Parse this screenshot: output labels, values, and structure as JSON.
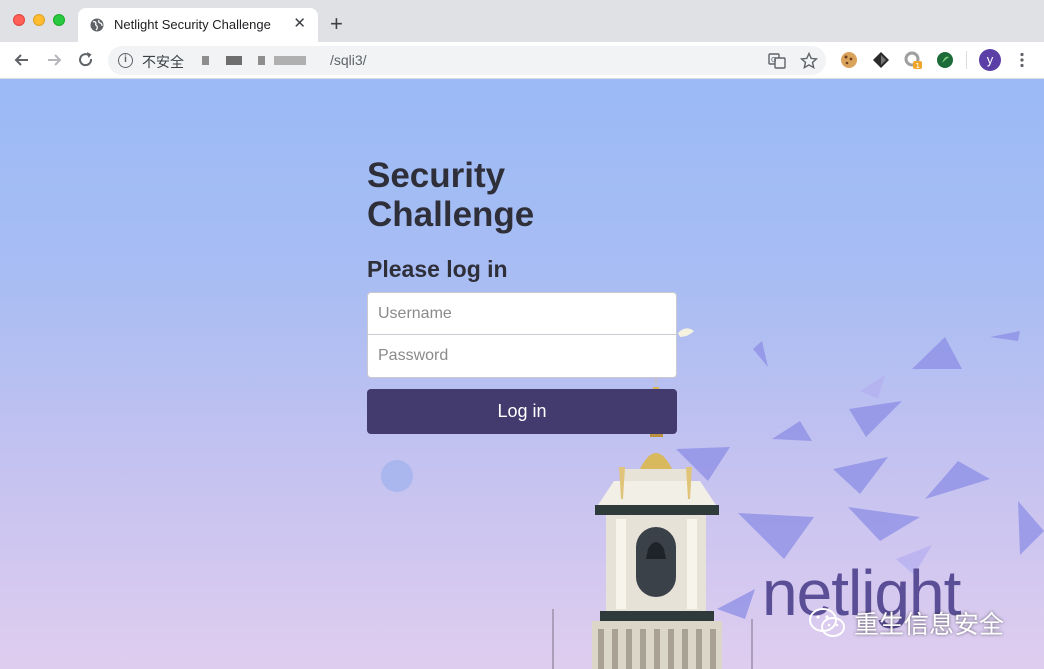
{
  "browser": {
    "tab_title": "Netlight Security Challenge",
    "tab_close": "✕",
    "new_tab": "+",
    "security_label": "不安全",
    "url_visible": "/sqli3/",
    "profile_initial": "y",
    "extension_badge": "1"
  },
  "page": {
    "title": "Security Challenge",
    "subtitle": "Please log in",
    "username_placeholder": "Username",
    "password_placeholder": "Password",
    "login_button": "Log in",
    "brand": "netlight"
  },
  "watermark": {
    "text": "重生信息安全"
  },
  "colors": {
    "button": "#433a6e",
    "brand": "#5a4f96",
    "sky_top": "#9bbaf6",
    "sky_bottom": "#dfcdef"
  }
}
